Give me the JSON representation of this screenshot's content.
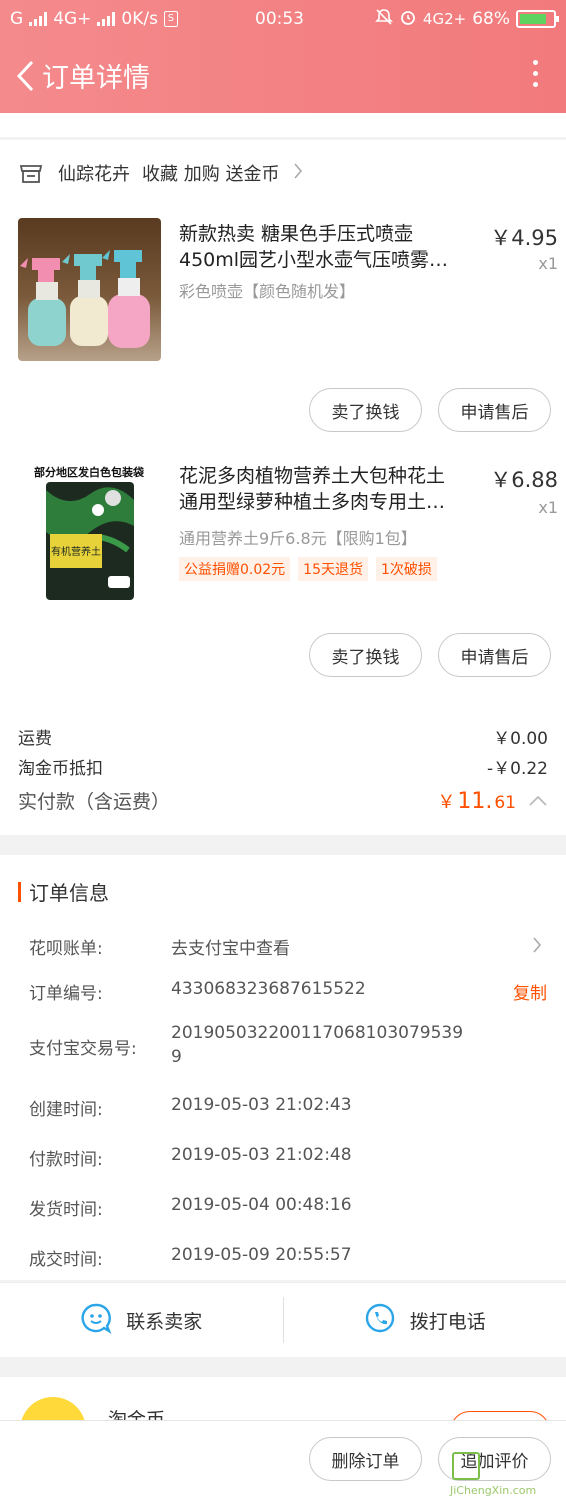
{
  "status_bar": {
    "carrier": "G",
    "network": "4G+",
    "speed": "0K/s",
    "time": "00:53",
    "network2": "4G2+",
    "battery": "68%"
  },
  "nav": {
    "title": "订单详情"
  },
  "shop": {
    "name": "仙踪花卉",
    "promo": "收藏 加购 送金币"
  },
  "products": [
    {
      "title_line1": "新款热卖 糖果色手压式喷壶",
      "title_line2": "450ml园艺小型水壶气压喷雾…",
      "sku": "彩色喷壶【颜色随机发】",
      "price": "￥4.95",
      "qty": "x1",
      "btn_sell": "卖了换钱",
      "btn_after": "申请售后"
    },
    {
      "title_line1": "花泥多肉植物营养土大包种花土",
      "title_line2": "通用型绿萝种植土多肉专用土…",
      "sku": "通用营养土9斤6.8元【限购1包】",
      "price": "￥6.88",
      "qty": "x1",
      "tags": [
        "公益捐赠0.02元",
        "15天退货",
        "1次破损"
      ],
      "btn_sell": "卖了换钱",
      "btn_after": "申请售后",
      "image_text": "部分地区发白色包装袋",
      "bag_label": "有机营养土"
    }
  ],
  "fees": {
    "shipping_label": "运费",
    "shipping_value": "￥0.00",
    "coin_label": "淘金币抵扣",
    "coin_value": "-￥0.22",
    "total_label": "实付款（含运费）",
    "total_currency": "￥",
    "total_int": "11.",
    "total_dec": "61"
  },
  "order_info": {
    "title": "订单信息",
    "rows": [
      {
        "label": "花呗账单:",
        "value": "去支付宝中查看"
      },
      {
        "label": "订单编号:",
        "value": "433068323687615522",
        "action": "复制"
      },
      {
        "label": "支付宝交易号:",
        "value_line1": "201905032200117068103079539",
        "value_line2": "9"
      },
      {
        "label": "创建时间:",
        "value": "2019-05-03 21:02:43"
      },
      {
        "label": "付款时间:",
        "value": "2019-05-03 21:02:48"
      },
      {
        "label": "发货时间:",
        "value": "2019-05-04 00:48:16"
      },
      {
        "label": "成交时间:",
        "value": "2019-05-09 20:55:57"
      }
    ]
  },
  "contact": {
    "seller": "联系卖家",
    "phone": "拨打电话"
  },
  "coin_section": {
    "title": "淘金币"
  },
  "bottom": {
    "delete": "删除订单",
    "review": "追加评价"
  },
  "watermark": "JiChengXin.com"
}
